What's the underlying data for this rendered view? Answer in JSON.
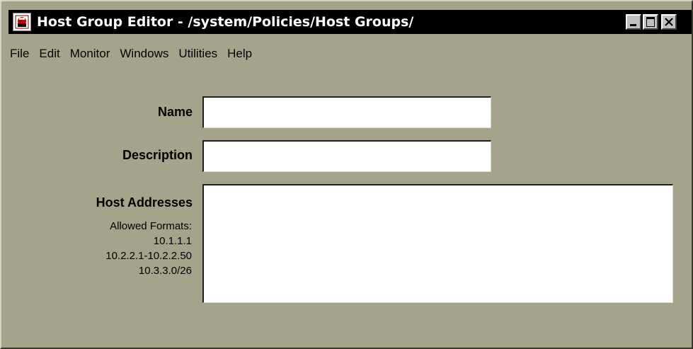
{
  "window": {
    "title": "Host Group Editor - /system/Policies/Host Groups/",
    "icon": "app-icon"
  },
  "menu": {
    "items": [
      "File",
      "Edit",
      "Monitor",
      "Windows",
      "Utilities",
      "Help"
    ]
  },
  "form": {
    "name_label": "Name",
    "name_value": "",
    "description_label": "Description",
    "description_value": "",
    "hosts_label": "Host Addresses",
    "hosts_value": "",
    "formats_heading": "Allowed Formats:",
    "formats": [
      "10.1.1.1",
      "10.2.2.1-10.2.2.50",
      "10.3.3.0/26"
    ]
  },
  "colors": {
    "background": "#a6a38d",
    "titlebar": "#000000",
    "field": "#ffffff"
  }
}
